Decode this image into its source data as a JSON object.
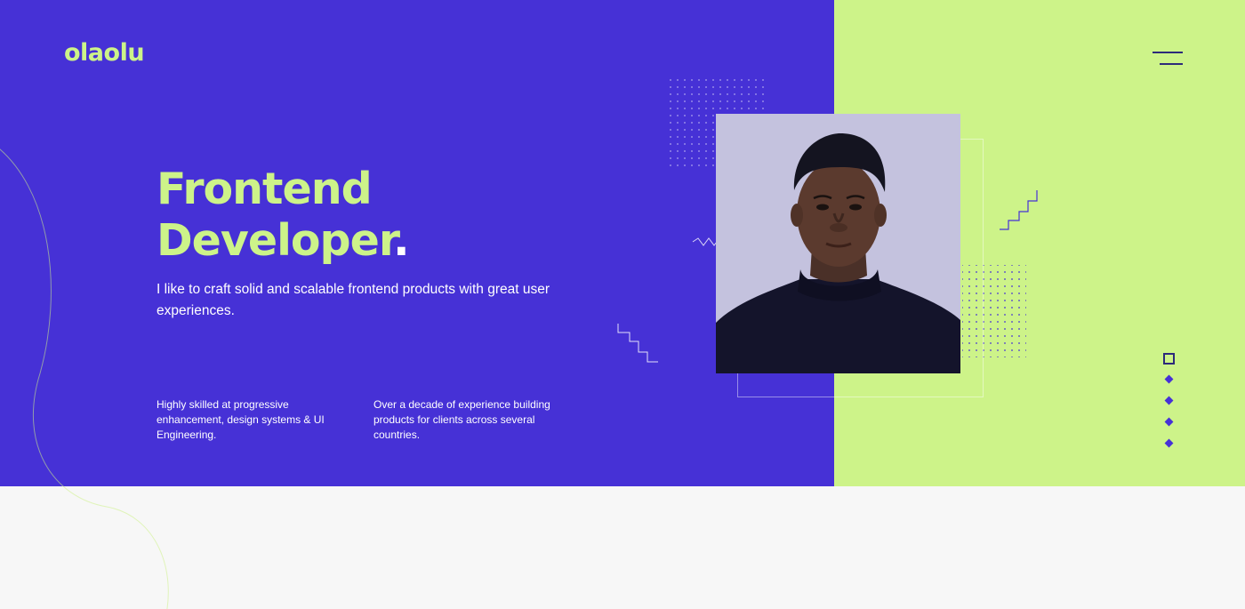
{
  "brand": {
    "logo_text": "olaolu"
  },
  "header": {
    "menu_icon": "hamburger-menu-icon"
  },
  "hero": {
    "title_line1": "Frontend",
    "title_line2": "Developer",
    "title_dot": ".",
    "subtitle": "I like to craft solid and scalable frontend products with great user experiences.",
    "features": [
      {
        "text": "Highly skilled at progressive enhancement, design systems & UI Engineering."
      },
      {
        "text": "Over a decade of experience building products for clients across several countries."
      }
    ]
  },
  "side_nav": {
    "items": [
      {
        "icon": "square-outline-icon",
        "active": true
      },
      {
        "icon": "diamond-icon",
        "active": false
      },
      {
        "icon": "diamond-icon",
        "active": false
      },
      {
        "icon": "diamond-icon",
        "active": false
      },
      {
        "icon": "diamond-icon",
        "active": false
      }
    ]
  },
  "colors": {
    "primary": "#4631d6",
    "accent": "#cdf389",
    "navy": "#2d2a7a",
    "background": "#f7f7f7",
    "text": "#ffffff"
  }
}
